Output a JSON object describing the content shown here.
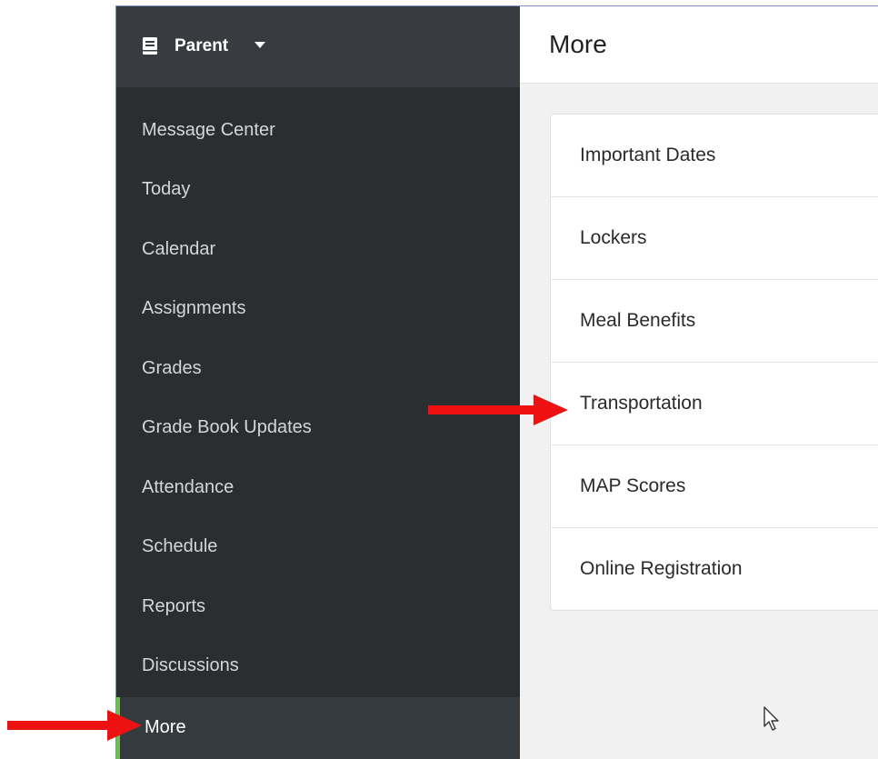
{
  "sidebar": {
    "header": {
      "label": "Parent",
      "icon": "book-icon",
      "dropdown_icon": "caret-down-icon"
    },
    "items": [
      {
        "label": "Message Center",
        "active": false
      },
      {
        "label": "Today",
        "active": false
      },
      {
        "label": "Calendar",
        "active": false
      },
      {
        "label": "Assignments",
        "active": false
      },
      {
        "label": "Grades",
        "active": false
      },
      {
        "label": "Grade Book Updates",
        "active": false
      },
      {
        "label": "Attendance",
        "active": false
      },
      {
        "label": "Schedule",
        "active": false
      },
      {
        "label": "Reports",
        "active": false
      },
      {
        "label": "Discussions",
        "active": false
      },
      {
        "label": "More",
        "active": true
      }
    ]
  },
  "main": {
    "title": "More",
    "items": [
      {
        "label": "Important Dates"
      },
      {
        "label": "Lockers"
      },
      {
        "label": "Meal Benefits"
      },
      {
        "label": "Transportation"
      },
      {
        "label": "MAP Scores"
      },
      {
        "label": "Online Registration"
      }
    ]
  },
  "annotations": {
    "arrow_color": "#ee1111",
    "arrows": [
      "arrow-to-transportation",
      "arrow-to-more"
    ]
  },
  "colors": {
    "sidebar_bg": "#2b2e31",
    "sidebar_header_bg": "#383c40",
    "active_accent": "#6fbf4d",
    "content_bg": "#f1f1f1"
  }
}
